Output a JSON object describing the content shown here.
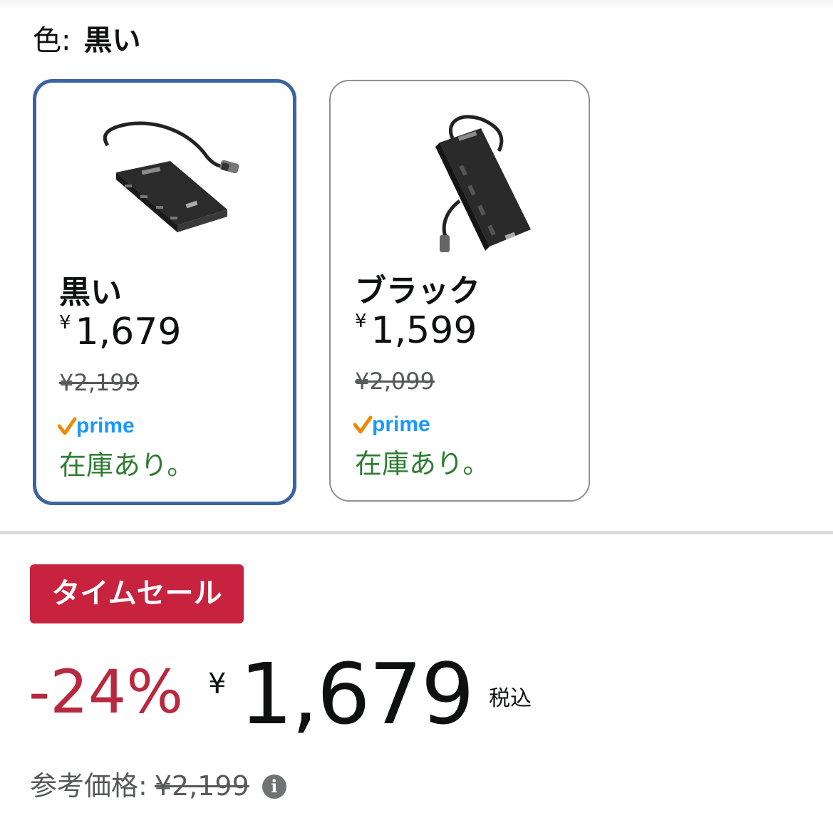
{
  "color_selector": {
    "label": "色:",
    "selected_value": "黒い"
  },
  "swatches": [
    {
      "name": "黒い",
      "currency": "¥",
      "price": "1,679",
      "list_price": "¥2,199",
      "prime": "prime",
      "stock": "在庫あり。",
      "selected": true
    },
    {
      "name": "ブラック",
      "currency": "¥",
      "price": "1,599",
      "list_price": "¥2,099",
      "prime": "prime",
      "stock": "在庫あり。",
      "selected": false
    }
  ],
  "deal": {
    "badge": "タイムセール",
    "discount": "-24%",
    "currency": "¥",
    "price": "1,679",
    "tax_label": "税込",
    "reference_label": "参考価格:",
    "reference_price": "¥2,199",
    "info_icon": "info-icon"
  },
  "colors": {
    "selected_border": "#3a63a0",
    "deal_red": "#c7233f",
    "stock_green": "#2e7d32",
    "prime_blue": "#1a98ff",
    "prime_orange": "#f08804"
  }
}
